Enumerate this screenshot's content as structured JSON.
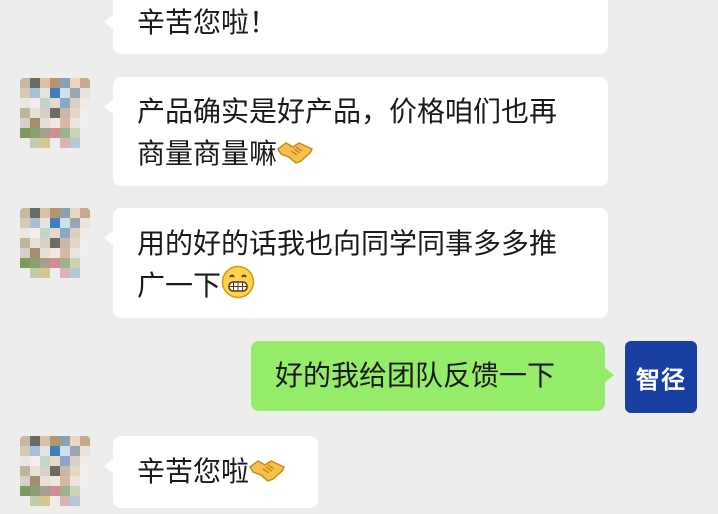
{
  "messages": [
    {
      "side": "left",
      "text": "辛苦您啦！",
      "emoji": null
    },
    {
      "side": "left",
      "text": "产品确实是好产品，价格咱们也再商量商量嘛",
      "emoji": "handshake-emoji"
    },
    {
      "side": "left",
      "text": "用的好的话我也向同学同事多多推广一下",
      "emoji": "grin-emoji"
    },
    {
      "side": "right",
      "text": "好的我给团队反馈一下",
      "emoji": null
    },
    {
      "side": "left",
      "text": "辛苦您啦",
      "emoji": "handshake-emoji"
    }
  ],
  "self_avatar": {
    "label": "智径",
    "color": "#1a3fa3"
  },
  "colors": {
    "background": "#ededed",
    "bubble_left": "#ffffff",
    "bubble_right": "#95ec69",
    "text": "#1a1a1a"
  }
}
